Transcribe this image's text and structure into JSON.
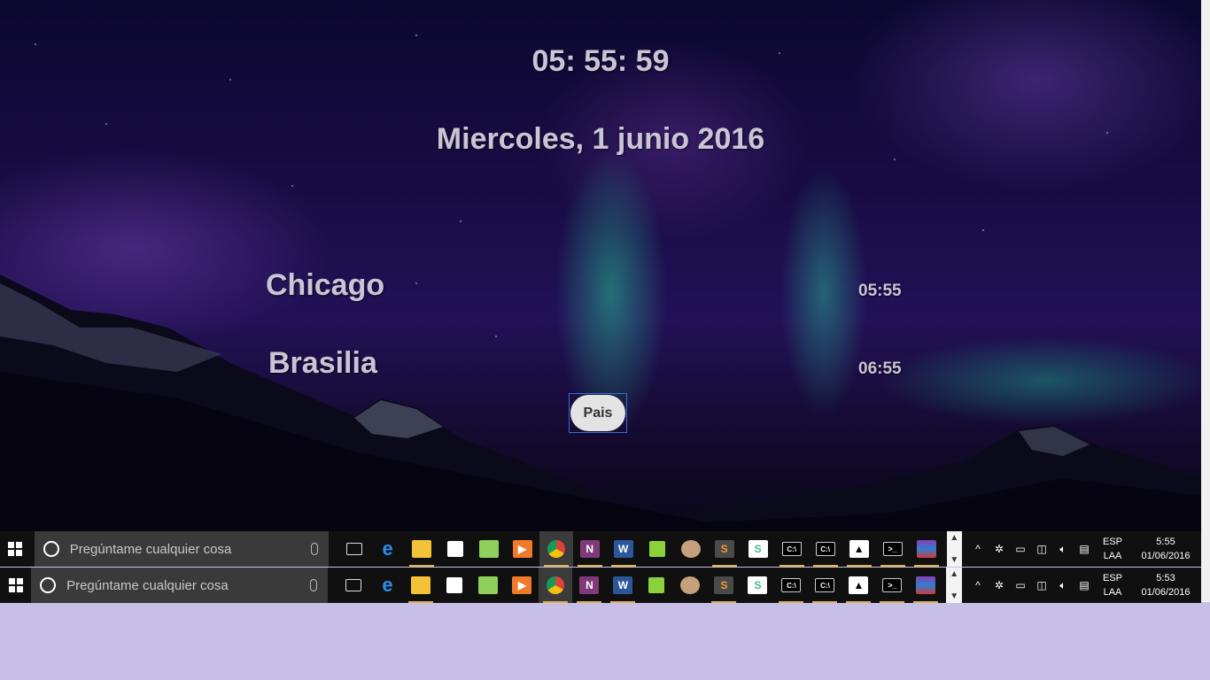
{
  "clock": "05: 55: 59",
  "date": "Miercoles, 1 junio 2016",
  "cities": [
    {
      "name": "Chicago",
      "time": "05:55"
    },
    {
      "name": "Brasilia",
      "time": "06:55"
    }
  ],
  "pais_button": "Pais",
  "taskbars": [
    {
      "search_placeholder": "Pregúntame cualquier cosa",
      "lang": "ESP",
      "layout": "LAA",
      "time": "5:55",
      "date": "01/06/2016"
    },
    {
      "search_placeholder": "Pregúntame cualquier cosa",
      "lang": "ESP",
      "layout": "LAA",
      "time": "5:53",
      "date": "01/06/2016"
    }
  ],
  "pinned_apps": [
    "task-view-icon",
    "edge-icon",
    "file-explorer-icon",
    "store-icon",
    "folder-icon",
    "media-player-icon",
    "chrome-icon",
    "onenote-icon",
    "word-icon",
    "green-app-icon",
    "gimp-icon",
    "sublime-icon",
    "slack-icon",
    "cmd-icon",
    "cmd-icon",
    "photos-icon",
    "terminal-icon",
    "winrar-icon"
  ],
  "tray_icons": [
    "chevron-up-icon",
    "settings-icon",
    "battery-icon",
    "network-icon",
    "volume-icon",
    "notification-icon"
  ],
  "colors": {
    "widget_text": "#c9c5d4",
    "taskbar": "#101010",
    "search_box": "#3a3a3a",
    "desktop_fill": "#c8bfe6"
  }
}
